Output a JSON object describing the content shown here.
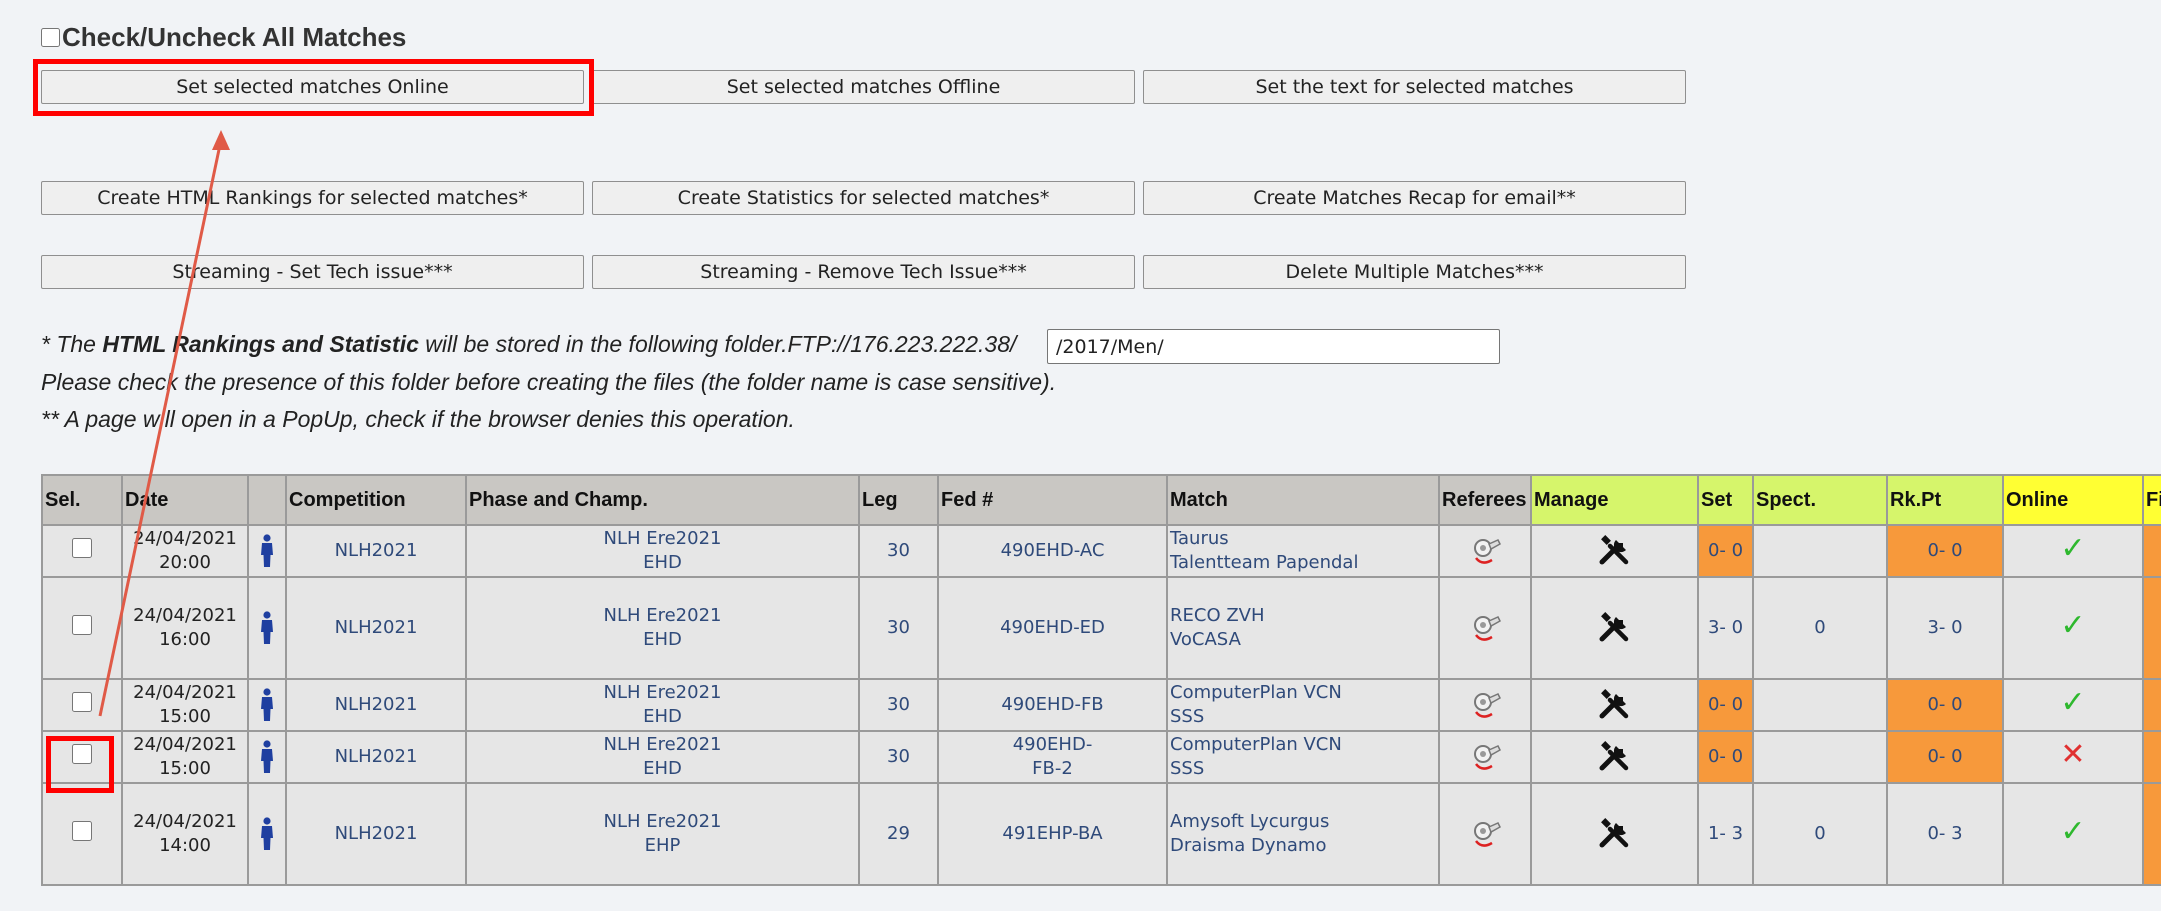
{
  "check_all": {
    "label": "Check/Uncheck All Matches"
  },
  "buttons": {
    "set_online": "Set selected matches Online",
    "set_offline": "Set selected matches Offline",
    "set_text": "Set the text for selected matches",
    "html_rankings": "Create HTML Rankings for selected matches*",
    "statistics": "Create Statistics for selected matches*",
    "recap": "Create Matches Recap for email**",
    "set_tech": "Streaming - Set Tech issue***",
    "remove_tech": "Streaming - Remove Tech Issue***",
    "delete": "Delete Multiple Matches***"
  },
  "notes": {
    "line1_a": "* The ",
    "line1_b": "HTML Rankings and Statistic",
    "line1_c": " will be stored in the following folder.FTP://176.223.222.38/",
    "folder_value": "/2017/Men/",
    "line2": "Please check the presence of this folder before creating the files (the folder name is case sensitive).",
    "line3": "** A page will open in a PopUp, check if the browser denies this operation."
  },
  "table": {
    "headers": {
      "sel": "Sel.",
      "date": "Date",
      "icon": "",
      "competition": "Competition",
      "phase": "Phase and Champ.",
      "leg": "Leg",
      "fed": "Fed #",
      "match": "Match",
      "referees": "Referees",
      "manage": "Manage",
      "set": "Set",
      "spect": "Spect.",
      "rkpt": "Rk.Pt",
      "online": "Online",
      "fi": "Fi"
    },
    "rows": [
      {
        "date": "24/04/2021",
        "time": "20:00",
        "comp": "NLH2021",
        "phase1": "NLH Ere2021",
        "phase2": "EHD",
        "leg": "30",
        "fed1": "490EHD-AC",
        "fed2": "",
        "team1": "Taurus",
        "team2": "Talentteam Papendal",
        "set": "0- 0",
        "spect": "",
        "rkpt": "0- 0",
        "online": "✓",
        "online_state": "ok"
      },
      {
        "date": "24/04/2021",
        "time": "16:00",
        "comp": "NLH2021",
        "phase1": "NLH Ere2021",
        "phase2": "EHD",
        "leg": "30",
        "fed1": "490EHD-ED",
        "fed2": "",
        "team1": "RECO ZVH",
        "team2": "VoCASA",
        "set": "3- 0",
        "spect": "0",
        "rkpt": "3- 0",
        "online": "✓",
        "online_state": "ok"
      },
      {
        "date": "24/04/2021",
        "time": "15:00",
        "comp": "NLH2021",
        "phase1": "NLH Ere2021",
        "phase2": "EHD",
        "leg": "30",
        "fed1": "490EHD-FB",
        "fed2": "",
        "team1": "ComputerPlan VCN",
        "team2": "SSS",
        "set": "0- 0",
        "spect": "",
        "rkpt": "0- 0",
        "online": "✓",
        "online_state": "ok"
      },
      {
        "date": "24/04/2021",
        "time": "15:00",
        "comp": "NLH2021",
        "phase1": "NLH Ere2021",
        "phase2": "EHD",
        "leg": "30",
        "fed1": "490EHD-",
        "fed2": "FB-2",
        "team1": "ComputerPlan VCN",
        "team2": "SSS",
        "set": "0- 0",
        "spect": "",
        "rkpt": "0- 0",
        "online": "✕",
        "online_state": "no"
      },
      {
        "date": "24/04/2021",
        "time": "14:00",
        "comp": "NLH2021",
        "phase1": "NLH Ere2021",
        "phase2": "EHP",
        "leg": "29",
        "fed1": "491EHP-BA",
        "fed2": "",
        "team1": "Amysoft Lycurgus",
        "team2": "Draisma Dynamo",
        "set": "1- 3",
        "spect": "0",
        "rkpt": "0- 3",
        "online": "✓",
        "online_state": "ok"
      }
    ]
  },
  "colors": {
    "highlight": "#ff0000",
    "orange_cell": "#f7993b",
    "green_header": "#d6f56b",
    "yellow_header": "#ffff33",
    "online_ok": "#2eb82e",
    "online_no": "#e03030"
  },
  "icons": {
    "person": "person-icon",
    "referee": "whistle-icon",
    "manage": "wrench-screwdriver-icon",
    "online_ok": "check-icon",
    "online_no": "cross-icon"
  }
}
